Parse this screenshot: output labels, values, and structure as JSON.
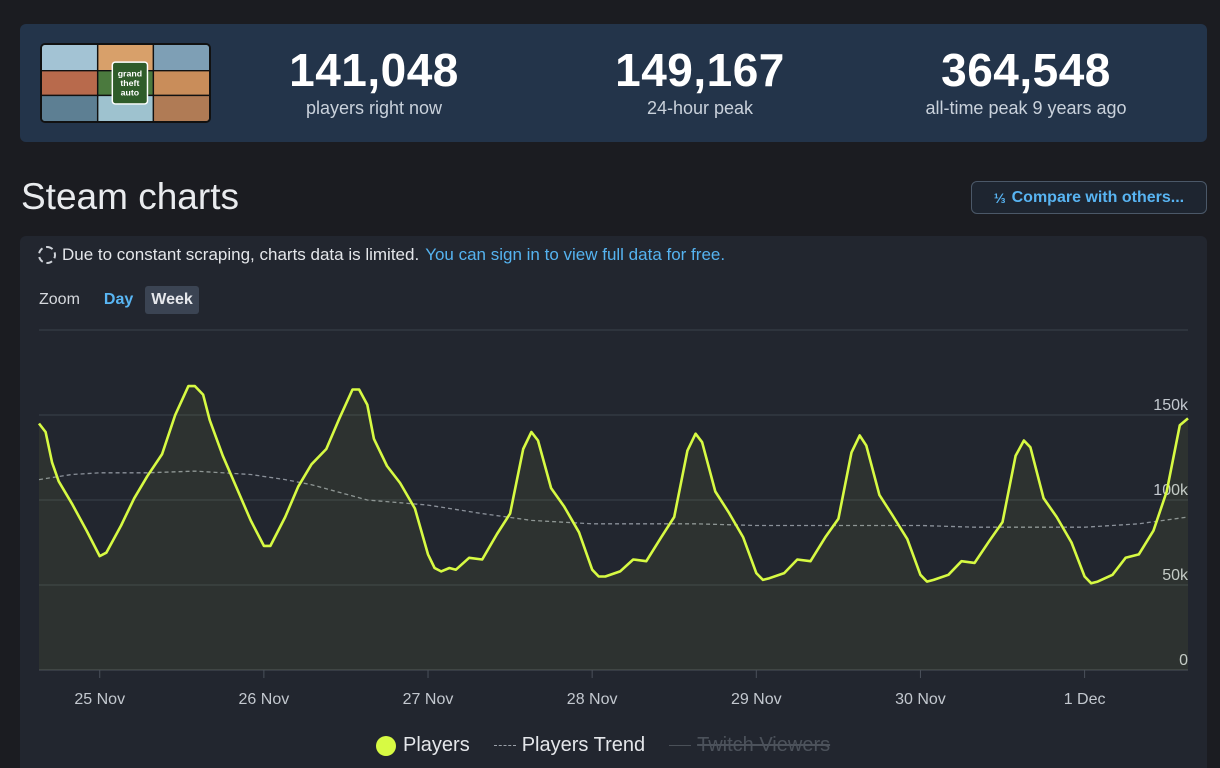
{
  "stats": {
    "now_value": "141,048",
    "now_label": "players right now",
    "peak24_value": "149,167",
    "peak24_label": "24-hour peak",
    "alltime_value": "364,548",
    "alltime_label": "all-time peak 9 years ago"
  },
  "section": {
    "title": "Steam charts",
    "compare_label": "Compare with others...",
    "compare_icon": "fraction-icon"
  },
  "notice": {
    "text": "Due to constant scraping, charts data is limited.",
    "link": "You can sign in to view full data for free."
  },
  "zoom": {
    "label": "Zoom",
    "options": [
      "Day",
      "Week"
    ],
    "selected": "Week"
  },
  "legend": {
    "players": "Players",
    "trend": "Players Trend",
    "twitch": "Twitch Viewers"
  },
  "colors": {
    "players_line": "#d7fa43",
    "trend_line": "#8a9099",
    "link": "#55b3f0",
    "panel": "#22262f",
    "stats_bar": "#23344a"
  },
  "chart_data": {
    "type": "line",
    "x_tick_labels": [
      "25 Nov",
      "26 Nov",
      "27 Nov",
      "28 Nov",
      "29 Nov",
      "30 Nov",
      "1 Dec"
    ],
    "y_tick_labels": [
      "0",
      "50k",
      "100k",
      "150k"
    ],
    "ylim": [
      0,
      200000
    ],
    "xlim": [
      24.63,
      31.63
    ],
    "grid": true,
    "legend_position": "bottom",
    "series": [
      {
        "name": "Players",
        "x": [
          24.63,
          24.67,
          24.71,
          24.75,
          24.83,
          24.92,
          25.0,
          25.04,
          25.13,
          25.21,
          25.29,
          25.38,
          25.46,
          25.54,
          25.58,
          25.63,
          25.67,
          25.75,
          25.83,
          25.92,
          26.0,
          26.04,
          26.13,
          26.21,
          26.29,
          26.38,
          26.46,
          26.54,
          26.58,
          26.63,
          26.67,
          26.75,
          26.83,
          26.92,
          27.0,
          27.04,
          27.08,
          27.13,
          27.17,
          27.25,
          27.33,
          27.42,
          27.5,
          27.58,
          27.63,
          27.67,
          27.75,
          27.83,
          27.92,
          28.0,
          28.04,
          28.08,
          28.17,
          28.25,
          28.33,
          28.42,
          28.5,
          28.58,
          28.63,
          28.67,
          28.75,
          28.83,
          28.92,
          29.0,
          29.04,
          29.08,
          29.17,
          29.25,
          29.33,
          29.42,
          29.5,
          29.58,
          29.63,
          29.67,
          29.75,
          29.83,
          29.92,
          30.0,
          30.04,
          30.08,
          30.17,
          30.25,
          30.33,
          30.42,
          30.5,
          30.58,
          30.63,
          30.67,
          30.75,
          30.83,
          30.92,
          31.0,
          31.04,
          31.08,
          31.17,
          31.25,
          31.33,
          31.42,
          31.5,
          31.58,
          31.63
        ],
        "y": [
          145000,
          140000,
          122000,
          111000,
          98000,
          82000,
          67000,
          69000,
          85000,
          101000,
          114000,
          127000,
          150000,
          167000,
          167000,
          162000,
          147000,
          126000,
          108000,
          88000,
          73000,
          73000,
          90000,
          108000,
          121000,
          130000,
          148000,
          165000,
          165000,
          156000,
          136000,
          120000,
          110000,
          95000,
          68000,
          60000,
          58000,
          60000,
          59000,
          66000,
          65000,
          80000,
          92000,
          130000,
          140000,
          135000,
          107000,
          96000,
          81000,
          59000,
          55000,
          55000,
          58000,
          65000,
          64000,
          78000,
          90000,
          129000,
          139000,
          134000,
          105000,
          93000,
          78000,
          57000,
          53000,
          54000,
          57000,
          65000,
          64000,
          78000,
          89000,
          128000,
          138000,
          132000,
          103000,
          91000,
          77000,
          56000,
          52000,
          53000,
          56000,
          64000,
          63000,
          76000,
          87000,
          126000,
          135000,
          131000,
          101000,
          90000,
          75000,
          55000,
          51000,
          52000,
          56000,
          66000,
          68000,
          82000,
          105000,
          144000,
          148000
        ]
      },
      {
        "name": "Players Trend",
        "x": [
          24.63,
          24.83,
          25.0,
          25.29,
          25.58,
          25.92,
          26.13,
          26.29,
          26.63,
          27.0,
          27.33,
          27.63,
          28.0,
          28.33,
          28.63,
          29.0,
          29.33,
          29.63,
          30.0,
          30.33,
          30.63,
          31.0,
          31.33,
          31.63
        ],
        "y": [
          112000,
          115000,
          116000,
          116000,
          117000,
          115000,
          112000,
          109000,
          100000,
          97000,
          92000,
          88000,
          86000,
          86000,
          86000,
          85000,
          85000,
          85000,
          85000,
          84000,
          84000,
          84000,
          86000,
          90000
        ]
      },
      {
        "name": "Twitch Viewers",
        "x": [],
        "y": []
      }
    ]
  }
}
